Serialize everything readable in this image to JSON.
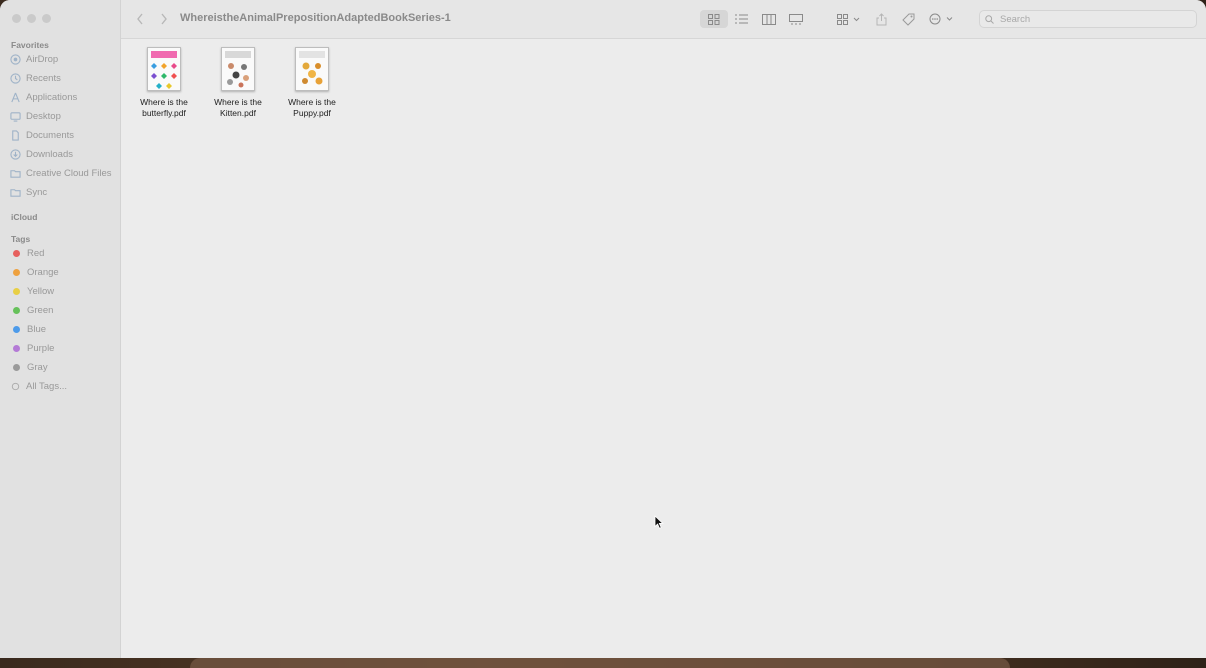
{
  "window": {
    "folder_title": "WhereistheAnimalPrepositionAdaptedBookSeries-1"
  },
  "sidebar": {
    "favorites_title": "Favorites",
    "favorites": [
      {
        "label": "AirDrop",
        "icon": "airdrop-icon"
      },
      {
        "label": "Recents",
        "icon": "clock-icon"
      },
      {
        "label": "Applications",
        "icon": "applications-icon"
      },
      {
        "label": "Desktop",
        "icon": "desktop-icon"
      },
      {
        "label": "Documents",
        "icon": "document-icon"
      },
      {
        "label": "Downloads",
        "icon": "download-icon"
      },
      {
        "label": "Creative Cloud Files",
        "icon": "folder-icon"
      },
      {
        "label": "Sync",
        "icon": "folder-icon"
      }
    ],
    "icloud_title": "iCloud",
    "tags_title": "Tags",
    "tags": [
      {
        "label": "Red",
        "color": "#e6605e"
      },
      {
        "label": "Orange",
        "color": "#eea13f"
      },
      {
        "label": "Yellow",
        "color": "#e8cf45"
      },
      {
        "label": "Green",
        "color": "#66c15a"
      },
      {
        "label": "Blue",
        "color": "#4d9bea"
      },
      {
        "label": "Purple",
        "color": "#b47ad6"
      },
      {
        "label": "Gray",
        "color": "#9a9a9a"
      }
    ],
    "all_tags_label": "All Tags..."
  },
  "toolbar": {
    "search_placeholder": "Search"
  },
  "files": [
    {
      "name_line1": "Where is the",
      "name_line2": "butterfly.pdf"
    },
    {
      "name_line1": "Where is the",
      "name_line2": "Kitten.pdf"
    },
    {
      "name_line1": "Where is the",
      "name_line2": "Puppy.pdf"
    }
  ]
}
